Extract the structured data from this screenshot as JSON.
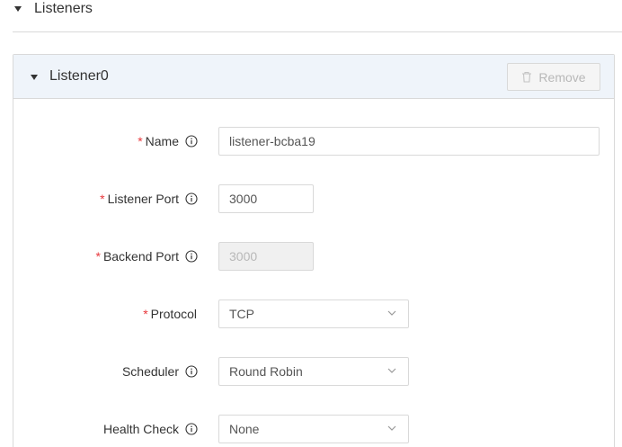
{
  "listeners_section": {
    "title": "Listeners"
  },
  "listener": {
    "title": "Listener0",
    "remove_label": "Remove"
  },
  "form": {
    "name": {
      "label": "Name",
      "required": "*",
      "value": "listener-bcba19"
    },
    "listener_port": {
      "label": "Listener Port",
      "required": "*",
      "value": "3000"
    },
    "backend_port": {
      "label": "Backend Port",
      "required": "*",
      "value": "3000"
    },
    "protocol": {
      "label": "Protocol",
      "required": "*",
      "value": "TCP"
    },
    "scheduler": {
      "label": "Scheduler",
      "value": "Round Robin"
    },
    "health_check": {
      "label": "Health Check",
      "value": "None"
    }
  },
  "colors": {
    "required": "#e8383d",
    "panel_header_bg": "#eff4fa",
    "border": "#d9d9d9"
  }
}
